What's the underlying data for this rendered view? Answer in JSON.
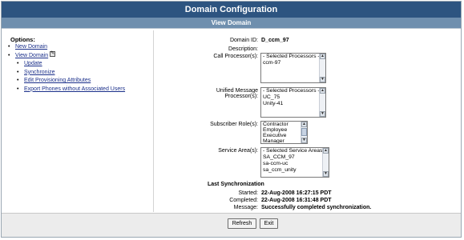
{
  "window": {
    "title": "Domain Configuration",
    "subtitle": "View Domain"
  },
  "sidebar": {
    "title": "Options:",
    "items": [
      {
        "label": "New Domain",
        "level": 0
      },
      {
        "label": "View Domain",
        "level": 0,
        "icon": "edit-icon"
      },
      {
        "label": "Update",
        "level": 1
      },
      {
        "label": "Synchronize",
        "level": 1
      },
      {
        "label": "Edit Provisioning Attributes",
        "level": 1
      },
      {
        "label": "Export Phones without Associated Users",
        "level": 1
      }
    ]
  },
  "form": {
    "domain_id_label": "Domain ID:",
    "domain_id_value": "D_ccm_97",
    "description_label": "Description:",
    "description_value": "",
    "call_processors_label": "Call Processor(s):",
    "call_processors": [
      "- Selected Processors -",
      "ccm-97"
    ],
    "unified_message_label_line1": "Unified Message",
    "unified_message_label_line2": "Processor(s):",
    "unified_message_processors": [
      "- Selected Processors -",
      "UC_75",
      "Unity-41"
    ],
    "subscriber_roles_label": "Subscriber Role(s):",
    "subscriber_roles": [
      "Contractor",
      "Employee",
      "Executive",
      "Manager"
    ],
    "service_areas_label": "Service Area(s):",
    "service_areas": [
      "- Selected Service Areas -",
      "SA_CCM_97",
      "sa-ccm-uc",
      "sa_ccm_unity"
    ]
  },
  "sync": {
    "title": "Last Synchronization",
    "started_label": "Started:",
    "started_value": "22-Aug-2008 16:27:15 PDT",
    "completed_label": "Completed:",
    "completed_value": "22-Aug-2008 16:31:48 PDT",
    "message_label": "Message:",
    "message_value": "Successfully completed synchronization."
  },
  "footer": {
    "refresh_label": "Refresh",
    "exit_label": "Exit"
  },
  "colors": {
    "title_bar": "#2d5480",
    "sub_bar": "#6f8fae",
    "link": "#1a2f8a"
  }
}
